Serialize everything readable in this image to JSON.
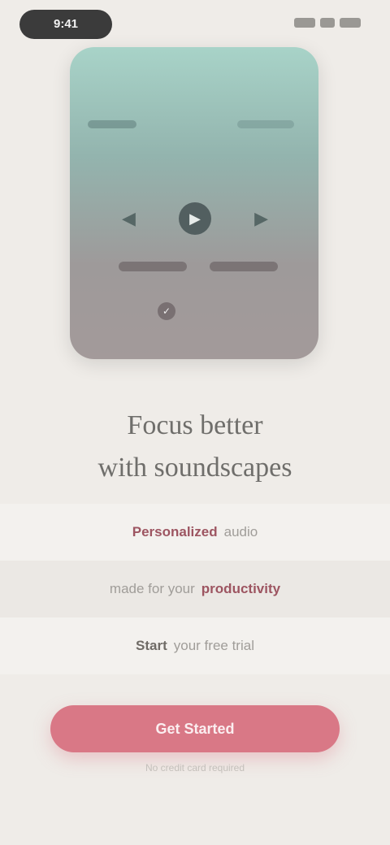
{
  "status_bar": {
    "time": "9:41"
  },
  "hero": {
    "controls": {
      "prev": "◀",
      "play": "▶",
      "next": "▶"
    },
    "badge": "✓"
  },
  "title": {
    "line1": "Focus better",
    "line2": "with soundscapes"
  },
  "features": [
    {
      "highlight": "Personalized",
      "text": "audio"
    },
    {
      "text": "made for your",
      "highlight": "productivity"
    },
    {
      "bold": "Start",
      "text": "your free trial"
    }
  ],
  "cta": {
    "label": "Get Started",
    "subtext": "No credit card required"
  },
  "colors": {
    "accent": "#d97886",
    "highlight": "#9d5561",
    "background": "#efece8"
  }
}
